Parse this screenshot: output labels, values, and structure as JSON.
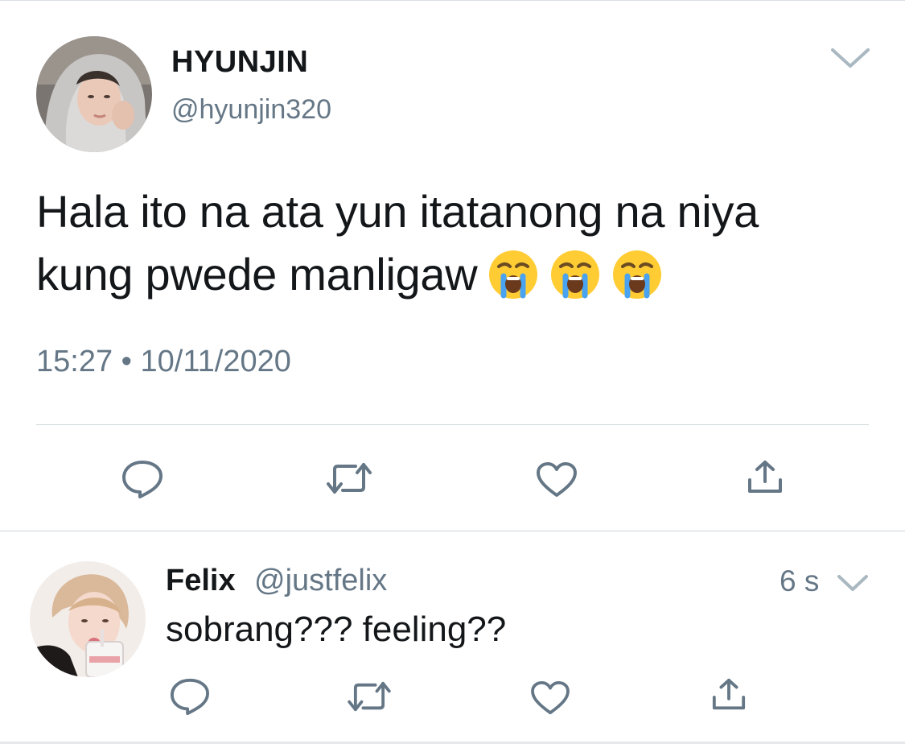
{
  "tweet": {
    "display_name": "HYUNJIN",
    "handle": "@hyunjin320",
    "text_line1": "Hala ito na ata yun itatanong na niya",
    "text_line2": "kung pwede manligaw",
    "emojis": [
      "loudly-crying-face",
      "loudly-crying-face",
      "loudly-crying-face"
    ],
    "timestamp": "15:27 • 10/11/2020",
    "actions": [
      "reply-icon",
      "retweet-icon",
      "like-icon",
      "share-icon"
    ]
  },
  "reply": {
    "display_name": "Felix",
    "handle": "@justfelix",
    "time": "6 s",
    "text": "sobrang??? feeling??",
    "actions": [
      "reply-icon",
      "retweet-icon",
      "like-icon",
      "share-icon"
    ]
  },
  "colors": {
    "text": "#14171a",
    "secondary": "#657786",
    "icon": "#657786",
    "divider": "#cfd5da"
  }
}
